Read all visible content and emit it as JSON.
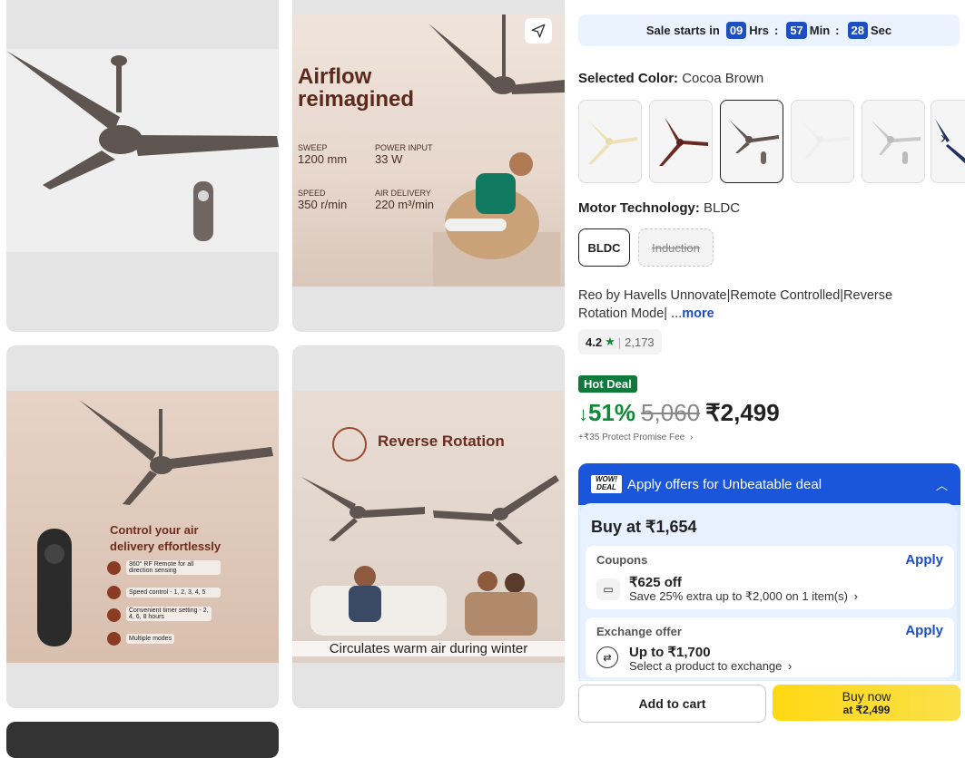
{
  "gallery": {
    "card2": {
      "title_line1": "Airflow",
      "title_line2": "reimagined",
      "specs": [
        {
          "label": "SWEEP",
          "value": "1200 mm"
        },
        {
          "label": "POWER INPUT",
          "value": "33 W"
        },
        {
          "label": "SPEED",
          "value": "350 r/min"
        },
        {
          "label": "AIR DELIVERY",
          "value": "220 m³/min"
        }
      ]
    },
    "card3": {
      "title_line1": "Control your air",
      "title_line2": "delivery effortlessly",
      "features": [
        "360° RF Remote for all direction sensing",
        "Speed control - 1, 2, 3, 4, 5",
        "Convenient timer setting - 2, 4, 6, 8 hours",
        "Multiple modes"
      ]
    },
    "card4": {
      "title": "Reverse Rotation",
      "caption": "Circulates warm air during winter"
    }
  },
  "sale": {
    "label": "Sale starts in",
    "hrs": "09",
    "hrs_unit": "Hrs",
    "min": "57",
    "min_unit": "Min",
    "sec": "28",
    "sec_unit": "Sec",
    "sep": ":"
  },
  "color": {
    "label": "Selected Color:",
    "value": "Cocoa Brown"
  },
  "motor": {
    "label": "Motor Technology:",
    "value": "BLDC",
    "options": [
      "BLDC",
      "Induction"
    ]
  },
  "product": {
    "title_line1": "Reo by Havells Unnovate|Remote Controlled|Reverse",
    "title_line2": "Rotation Mode| ...",
    "more": "more"
  },
  "rating": {
    "score": "4.2",
    "count": "2,173"
  },
  "price": {
    "badge": "Hot Deal",
    "discount": "51%",
    "mrp": "5,060",
    "price": "₹2,499",
    "fee": "+₹35 Protect Promise Fee"
  },
  "offers": {
    "logo_line1": "WOW!",
    "logo_line2": "DEAL",
    "header": "Apply offers for Unbeatable deal",
    "buy_at": "Buy at ₹1,654",
    "coupon": {
      "title": "Coupons",
      "apply": "Apply",
      "amount": "₹625 off",
      "desc": "Save 25% extra up to ₹2,000 on 1 item(s)"
    },
    "exchange": {
      "title": "Exchange offer",
      "apply": "Apply",
      "amount": "Up to ₹1,700",
      "desc": "Select a product to exchange"
    }
  },
  "actions": {
    "add_to_cart": "Add to cart",
    "buy_now": "Buy now",
    "buy_now_price": "at ₹2,499"
  },
  "colors": {
    "accent": "#1e4fc0",
    "green": "#108934",
    "hot_deal": "#0f7a3a",
    "buy_now": "#ffd814",
    "offer_header": "#1a56db"
  }
}
